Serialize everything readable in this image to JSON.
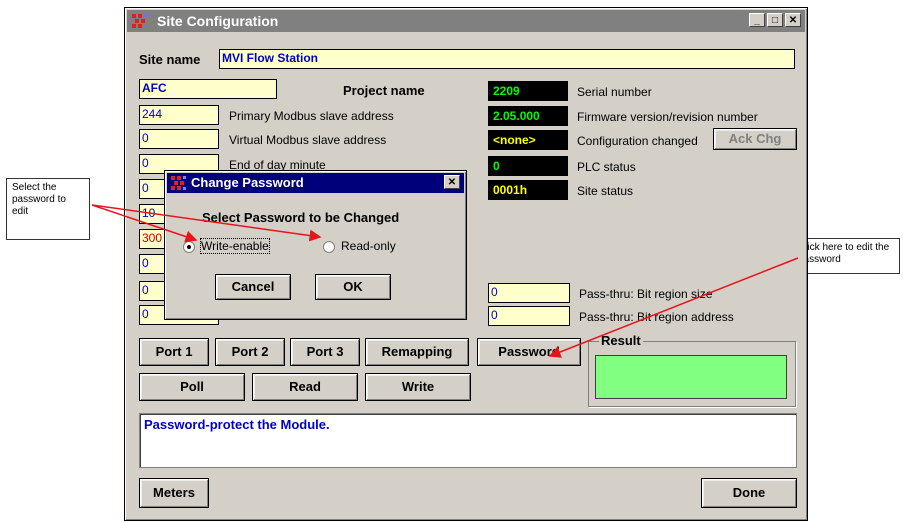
{
  "callouts": {
    "left": "Select the password to edit",
    "right": "Click here to edit the password"
  },
  "window": {
    "title": "Site Configuration",
    "site_name_label": "Site name",
    "site_name_value": "MVI Flow Station",
    "project_name_value": "AFC",
    "project_name_label": "Project name",
    "left_fields": [
      {
        "value": "244",
        "label": "Primary Modbus slave address"
      },
      {
        "value": "0",
        "label": "Virtual Modbus slave address"
      },
      {
        "value": "0",
        "label": "End of day minute"
      },
      {
        "value": "0",
        "label": ""
      },
      {
        "value": "10",
        "label": ""
      },
      {
        "value": "300",
        "label": ""
      },
      {
        "value": "0",
        "label": ""
      },
      {
        "value": "0",
        "label": ""
      },
      {
        "value": "0",
        "label": ""
      }
    ],
    "status_fields": [
      {
        "value": "2209",
        "label": "Serial number",
        "color": "#00ff00"
      },
      {
        "value": "2.05.000",
        "label": "Firmware version/revision number",
        "color": "#00ff00"
      },
      {
        "value": "<none>",
        "label": "Configuration changed",
        "color": "#ffff00"
      },
      {
        "value": "0",
        "label": "PLC status",
        "color": "#00ff00"
      },
      {
        "value": "0001h",
        "label": "Site status",
        "color": "#ffff00"
      }
    ],
    "ack_button": "Ack Chg",
    "passthru": [
      {
        "value": "0",
        "label": "Pass-thru: Bit region size"
      },
      {
        "value": "0",
        "label": "Pass-thru: Bit region address"
      }
    ],
    "buttons": {
      "port1": "Port 1",
      "port2": "Port 2",
      "port3": "Port 3",
      "remapping": "Remapping",
      "password": "Password",
      "poll": "Poll",
      "read": "Read",
      "write": "Write",
      "meters": "Meters",
      "done": "Done"
    },
    "result_label": "Result",
    "result_color": "#80ff80",
    "message": "Password-protect the Module."
  },
  "dialog": {
    "title": "Change Password",
    "heading": "Select Password to be Changed",
    "option_write": "Write-enable",
    "option_read": "Read-only",
    "selected": "Write-enable",
    "cancel": "Cancel",
    "ok": "OK"
  },
  "colors": {
    "title_inactive": "#808080",
    "title_active": "#00007b",
    "field_bg": "#ffffcc",
    "arrow": "#e8141c"
  }
}
